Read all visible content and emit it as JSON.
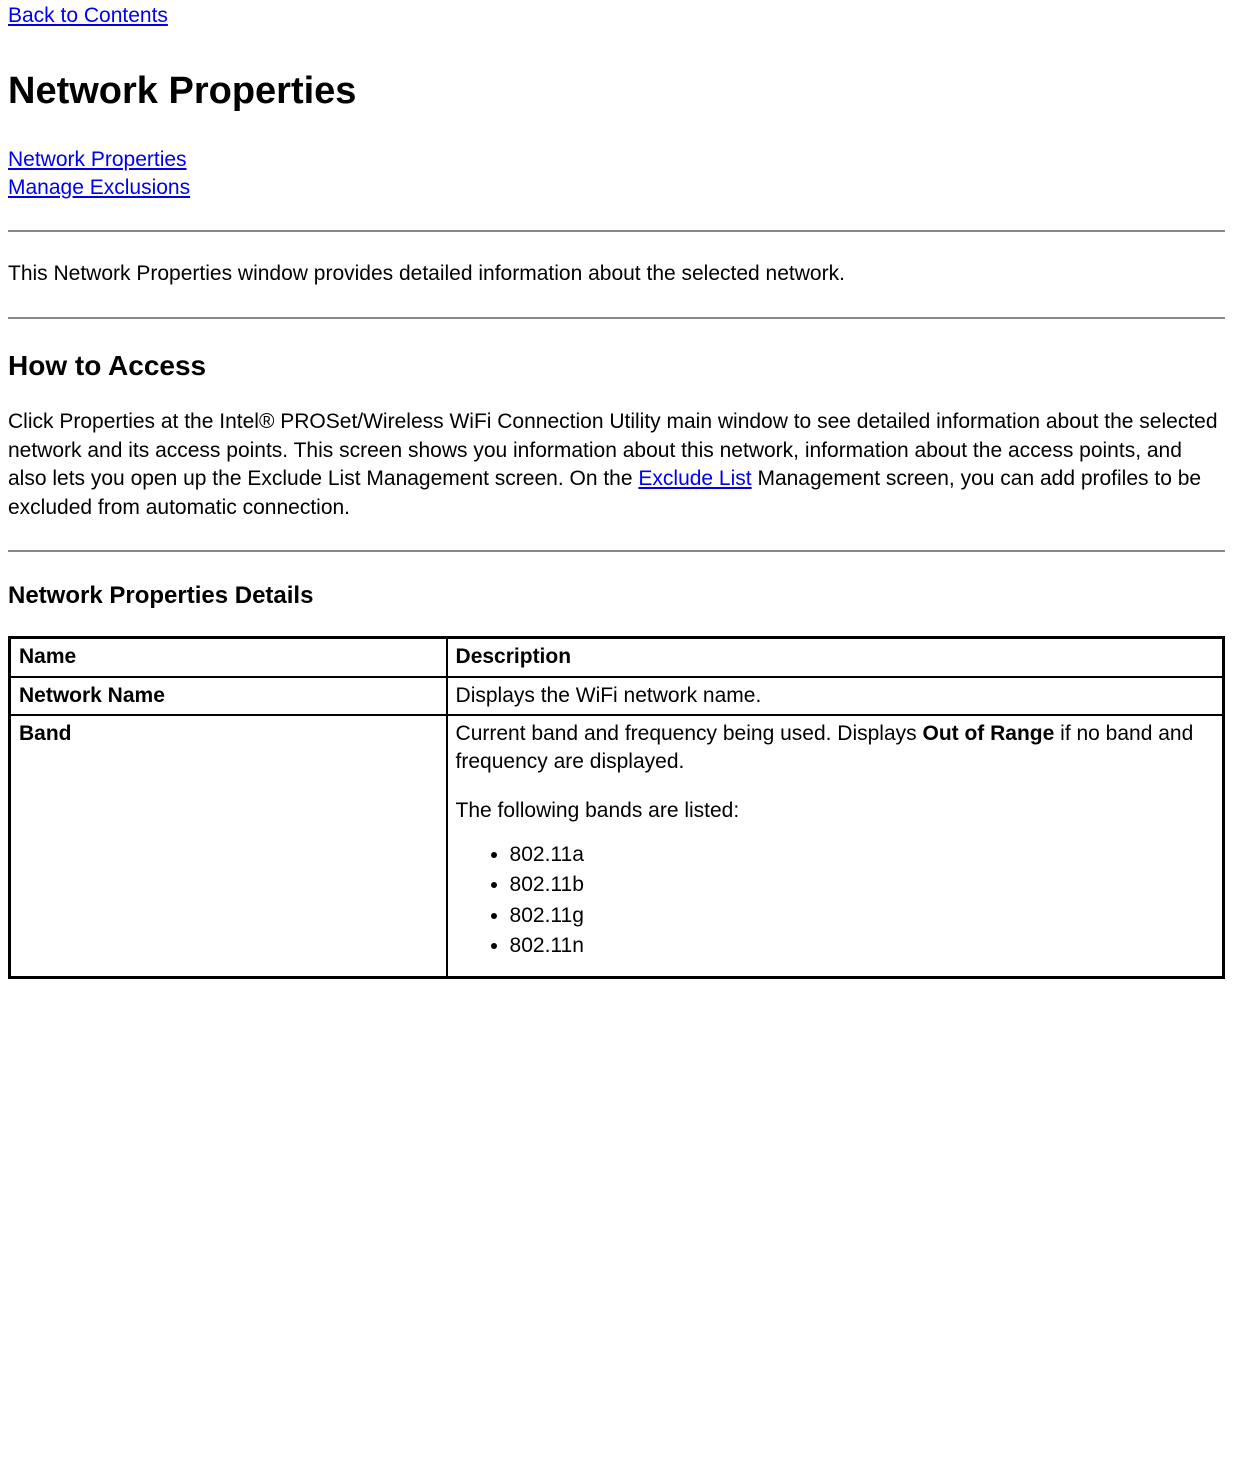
{
  "top_link": "Back to Contents",
  "page_title": "Network Properties",
  "nav": {
    "link1": "Network Properties",
    "link2": "Manage Exclusions"
  },
  "intro": "This Network Properties window provides detailed information about the selected network.",
  "how_to_access": {
    "heading": "How to Access",
    "body_before": "Click Properties at the Intel® PROSet/Wireless WiFi Connection Utility main window to see detailed information about the selected network and its access points. This screen shows you information about this network, information about the access points, and also lets you open up the Exclude List Management screen. On the ",
    "exclude_link": "Exclude List",
    "body_after": " Management screen, you can add profiles to be excluded from automatic connection."
  },
  "details": {
    "heading": "Network Properties Details",
    "headers": {
      "name": "Name",
      "description": "Description"
    },
    "rows": {
      "network_name": {
        "label": "Network Name",
        "desc": "Displays the WiFi network name."
      },
      "band": {
        "label": "Band",
        "desc_pre": "Current band and frequency being used. Displays ",
        "desc_bold": "Out of Range",
        "desc_post": " if no band and frequency are displayed.",
        "bands_intro": "The following bands are listed:",
        "bands": [
          "802.11a",
          "802.11b",
          "802.11g",
          "802.11n"
        ]
      }
    }
  }
}
